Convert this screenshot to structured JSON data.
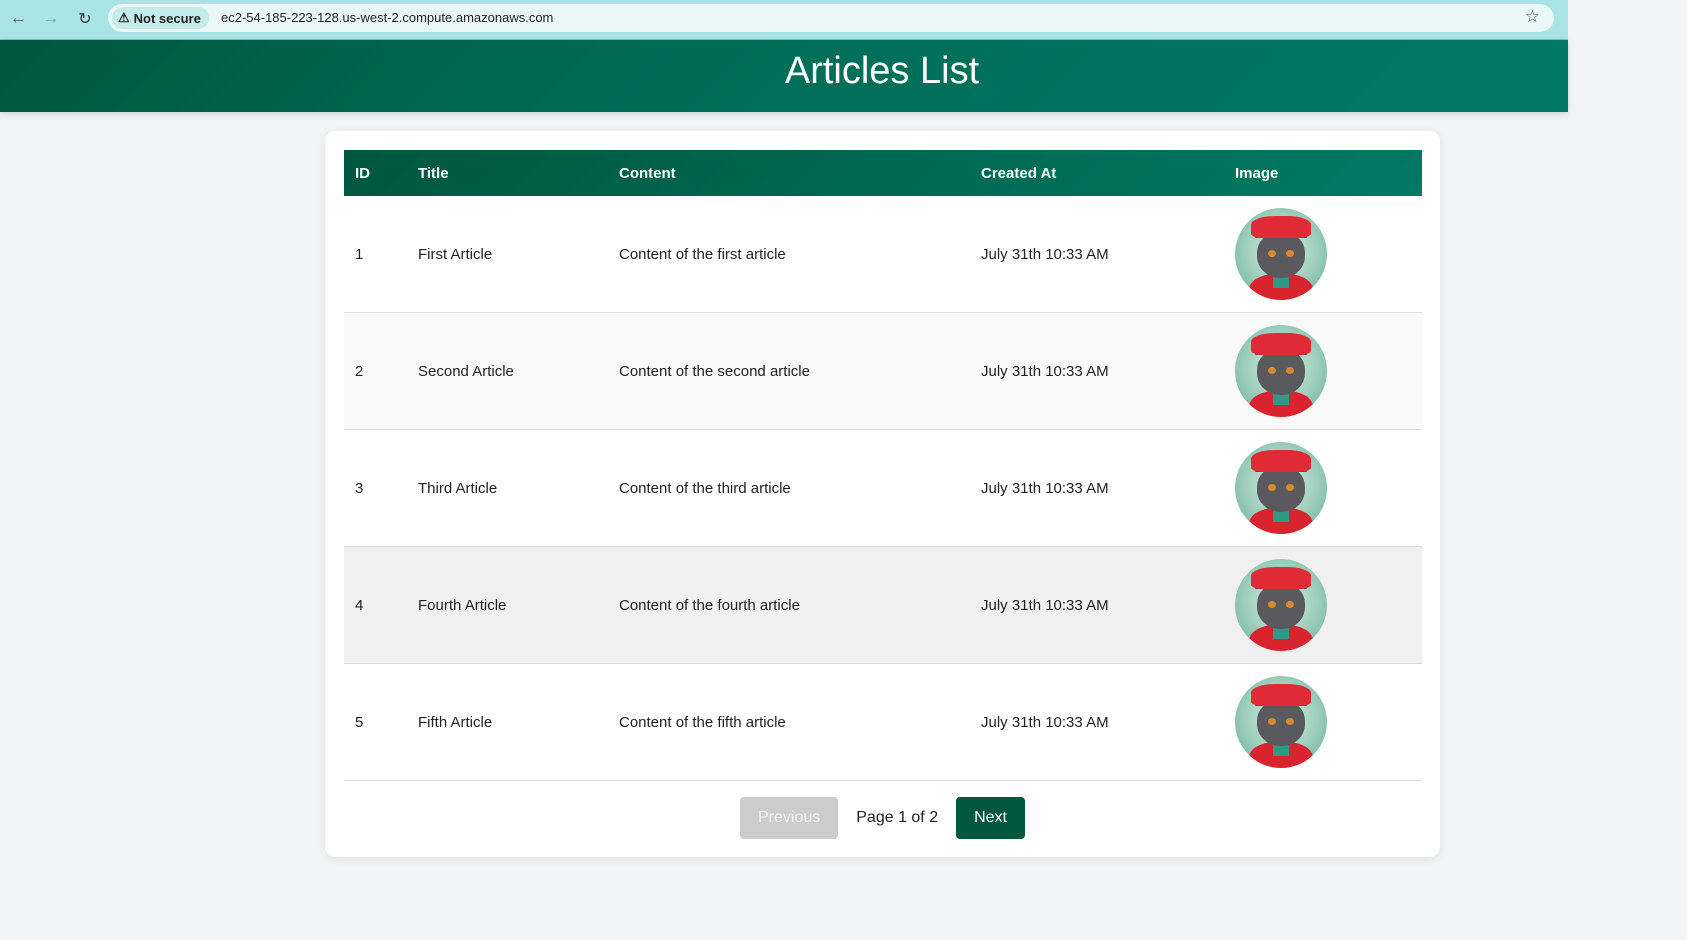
{
  "browser": {
    "back_icon": "←",
    "forward_icon": "→",
    "reload_icon": "↻",
    "security_icon": "⚠",
    "security_label": "Not secure",
    "url": "ec2-54-185-223-128.us-west-2.compute.amazonaws.com",
    "bookmark_icon": "☆"
  },
  "header": {
    "title": "Articles List"
  },
  "table": {
    "columns": [
      "ID",
      "Title",
      "Content",
      "Created At",
      "Image"
    ],
    "rows": [
      {
        "id": "1",
        "title": "First Article",
        "content": "Content of the first article",
        "created_at": "July 31th 10:33 AM",
        "image": "cat-avatar"
      },
      {
        "id": "2",
        "title": "Second Article",
        "content": "Content of the second article",
        "created_at": "July 31th 10:33 AM",
        "image": "cat-avatar"
      },
      {
        "id": "3",
        "title": "Third Article",
        "content": "Content of the third article",
        "created_at": "July 31th 10:33 AM",
        "image": "cat-avatar"
      },
      {
        "id": "4",
        "title": "Fourth Article",
        "content": "Content of the fourth article",
        "created_at": "July 31th 10:33 AM",
        "image": "cat-avatar"
      },
      {
        "id": "5",
        "title": "Fifth Article",
        "content": "Content of the fifth article",
        "created_at": "July 31th 10:33 AM",
        "image": "cat-avatar"
      }
    ]
  },
  "pagination": {
    "previous_label": "Previous",
    "next_label": "Next",
    "page_info": "Page 1 of 2",
    "current_page": 1,
    "total_pages": 2
  },
  "colors": {
    "brand": "#005740",
    "header_gradient_end": "#007a66",
    "disabled_button": "#cccccc"
  }
}
